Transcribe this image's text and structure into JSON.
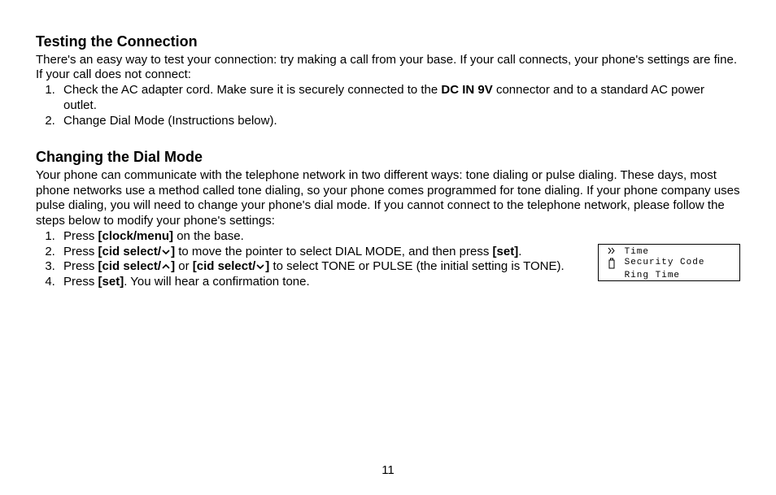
{
  "sections": {
    "testing": {
      "heading": "Testing the Connection",
      "intro": "There's an easy way to test your connection: try making a call from your base. If your call connects, your phone's settings are fine. If your call does not connect:",
      "items": [
        {
          "pre": "Check the AC adapter cord. Make sure it is securely connected to the ",
          "bold": "DC IN 9V",
          "post": " connector and to a standard AC power outlet."
        },
        {
          "pre": "Change Dial Mode (Instructions below).",
          "bold": "",
          "post": ""
        }
      ]
    },
    "dialmode": {
      "heading": "Changing the Dial Mode",
      "intro": "Your phone can communicate with the telephone network in two different ways: tone dialing or pulse dialing. These days, most phone networks use a method called tone dialing, so your phone comes programmed for tone dialing. If your phone company uses pulse dialing, you will need to change your phone's dial mode. If you cannot connect to the telephone network, please follow the steps below to modify your phone's settings:",
      "step1": {
        "a": "Press ",
        "b": "[clock/menu]",
        "c": " on the base."
      },
      "step2": {
        "a": "Press ",
        "b": "[cid select/",
        "c": "]",
        "d": " to move the pointer to select DIAL MODE, and then press ",
        "e": "[set]",
        "f": "."
      },
      "step3": {
        "a": "Press ",
        "b": "[cid select/",
        "c": "]",
        "d": " or ",
        "e": "[cid select/",
        "f": "]",
        "g": " to select TONE or PULSE (the initial setting is TONE)."
      },
      "step4": {
        "a": "Press ",
        "b": "[set]",
        "c": ". You will hear a confirmation tone."
      }
    }
  },
  "lcd": {
    "line1": "Time",
    "line2": "Security Code",
    "line3": "Ring Time"
  },
  "page_number": "11"
}
